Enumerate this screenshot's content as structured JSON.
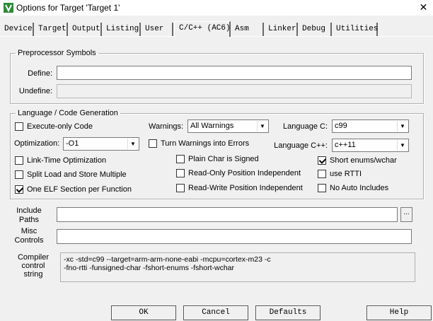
{
  "window": {
    "title": "Options for Target 'Target 1'",
    "close_glyph": "✕"
  },
  "tabs": [
    "Device",
    "Target",
    "Output",
    "Listing",
    "User",
    "C/C++ (AC6)",
    "Asm",
    "Linker",
    "Debug",
    "Utilities"
  ],
  "preprocessor": {
    "legend": "Preprocessor Symbols",
    "define_label": "Define:",
    "define_value": "",
    "undefine_label": "Undefine:",
    "undefine_value": ""
  },
  "lang": {
    "legend": "Language / Code Generation",
    "execute_only": "Execute-only Code",
    "optimization_label": "Optimization:",
    "optimization_value": "-O1",
    "link_time": "Link-Time Optimization",
    "split_load": "Split Load and Store Multiple",
    "one_elf": "One ELF Section per Function",
    "warnings_label": "Warnings:",
    "warnings_value": "All Warnings",
    "turn_warnings": "Turn Warnings into Errors",
    "plain_char": "Plain Char is Signed",
    "ro_pos": "Read-Only Position Independent",
    "rw_pos": "Read-Write Position Independent",
    "lang_c_label": "Language C:",
    "lang_c_value": "c99",
    "lang_cpp_label": "Language C++:",
    "lang_cpp_value": "c++11",
    "short_enums": "Short enums/wchar",
    "use_rtti": "use RTTI",
    "no_auto": "No Auto Includes"
  },
  "include": {
    "label1": "Include",
    "label2": "Paths",
    "value": "",
    "browse": "..."
  },
  "misc": {
    "label1": "Misc",
    "label2": "Controls",
    "value": ""
  },
  "compiler": {
    "label1": "Compiler",
    "label2": "control",
    "label3": "string",
    "line1": "-xc -std=c99 --target=arm-arm-none-eabi -mcpu=cortex-m23 -c",
    "line2": "-fno-rtti -funsigned-char -fshort-enums -fshort-wchar"
  },
  "buttons": {
    "ok": "OK",
    "cancel": "Cancel",
    "defaults": "Defaults",
    "help": "Help"
  }
}
